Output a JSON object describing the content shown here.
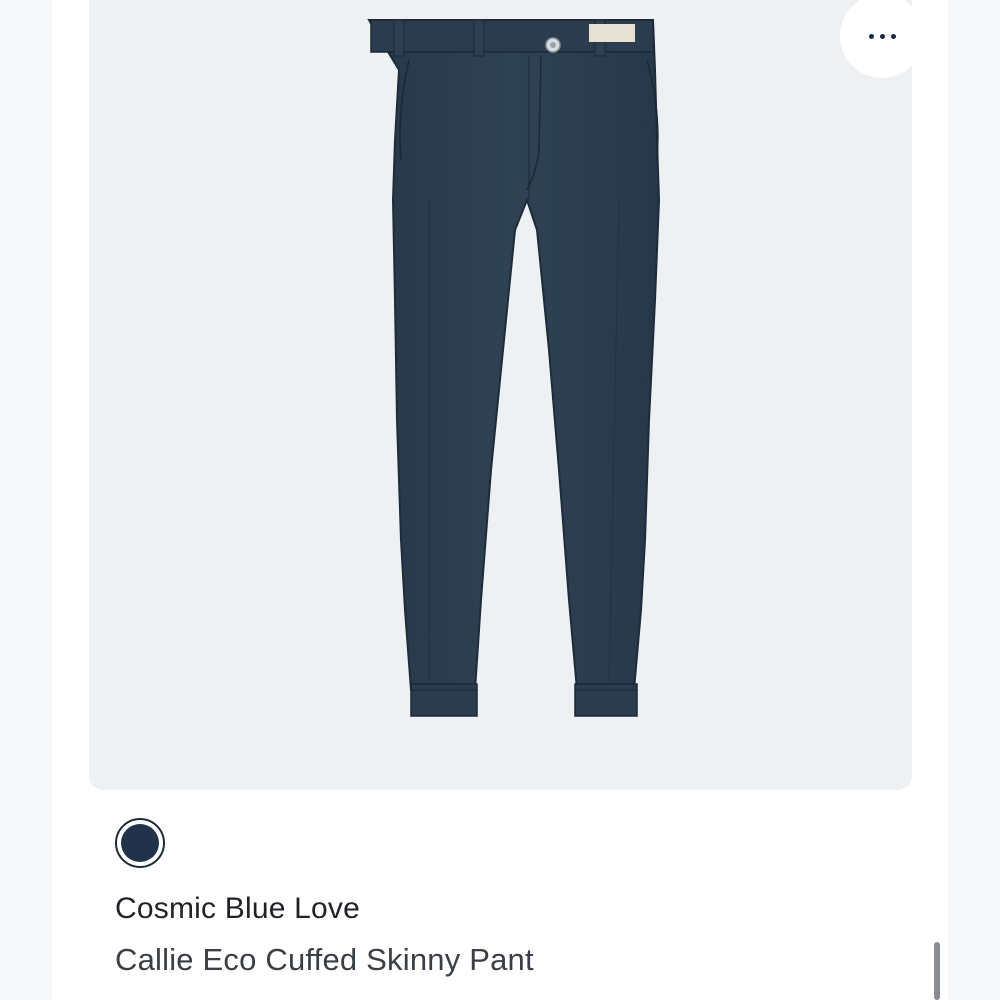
{
  "more_button": {
    "icon": "more-horizontal-icon",
    "aria_label": "More options"
  },
  "product": {
    "image_subject": "cuffed skinny pant",
    "swatch": {
      "icon": "color-swatch",
      "color": "#22324a"
    },
    "color_name": "Cosmic Blue Love",
    "name": "Callie Eco Cuffed Skinny Pant"
  },
  "colors": {
    "page_background": "#ffffff",
    "photo_background": "#edf1f3",
    "garment": "#2b3d4d",
    "text_primary": "#1f2328",
    "text_secondary": "#3a3f45"
  }
}
